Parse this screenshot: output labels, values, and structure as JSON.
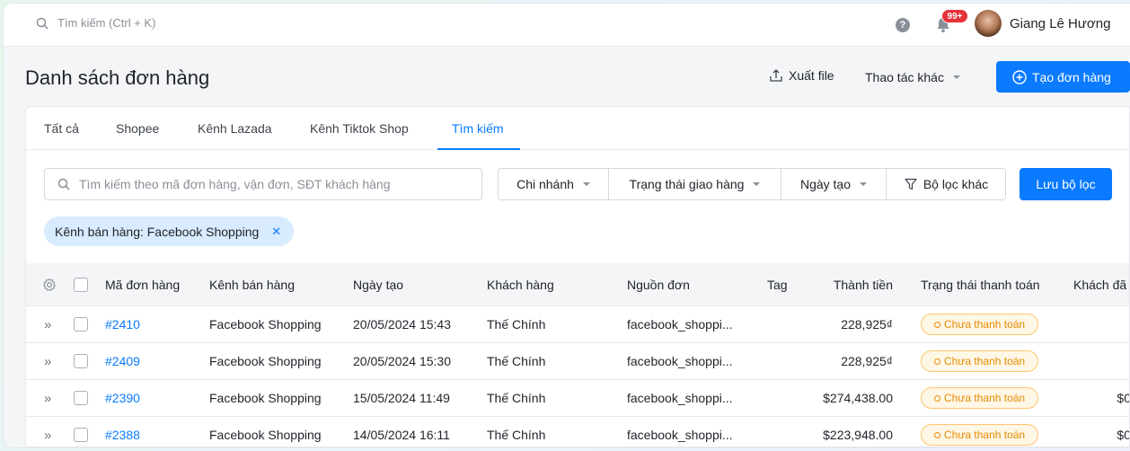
{
  "topbar": {
    "search_placeholder": "Tìm kiếm (Ctrl + K)",
    "notification_count": "99+",
    "user_name": "Giang Lê Hương"
  },
  "header": {
    "title": "Danh sách đơn hàng",
    "export_label": "Xuất file",
    "more_actions_label": "Thao tác khác",
    "create_label": "Tạo đơn hàng"
  },
  "tabs": [
    "Tất cả",
    "Shopee",
    "Kênh Lazada",
    "Kênh Tiktok Shop",
    "Tìm kiếm"
  ],
  "active_tab": "Tìm kiếm",
  "filters": {
    "search_placeholder": "Tìm kiếm theo mã đơn hàng, vận đơn, SĐT khách hàng",
    "branch": "Chi nhánh",
    "delivery_status": "Trạng thái giao hàng",
    "created_date": "Ngày tạo",
    "other_filters": "Bộ lọc khác",
    "save_filter": "Lưu bộ lọc",
    "active_chip": "Kênh bán hàng: Facebook Shopping"
  },
  "table": {
    "columns": [
      "Mã đơn hàng",
      "Kênh bán hàng",
      "Ngày tạo",
      "Khách hàng",
      "Nguồn đơn",
      "Tag",
      "Thành tiền",
      "Trạng thái thanh toán",
      "Khách đã"
    ],
    "rows": [
      {
        "id": "#2410",
        "channel": "Facebook Shopping",
        "date": "20/05/2024 15:43",
        "customer": "Thế Chính",
        "source": "facebook_shoppi...",
        "tag": "",
        "total": "228,925₫",
        "payment_status": "Chưa thanh toán",
        "paid": ""
      },
      {
        "id": "#2409",
        "channel": "Facebook Shopping",
        "date": "20/05/2024 15:30",
        "customer": "Thế Chính",
        "source": "facebook_shoppi...",
        "tag": "",
        "total": "228,925₫",
        "payment_status": "Chưa thanh toán",
        "paid": ""
      },
      {
        "id": "#2390",
        "channel": "Facebook Shopping",
        "date": "15/05/2024 11:49",
        "customer": "Thế Chính",
        "source": "facebook_shoppi...",
        "tag": "",
        "total": "$274,438.00",
        "payment_status": "Chưa thanh toán",
        "paid": "$0"
      },
      {
        "id": "#2388",
        "channel": "Facebook Shopping",
        "date": "14/05/2024 16:11",
        "customer": "Thế Chính",
        "source": "facebook_shoppi...",
        "tag": "",
        "total": "$223,948.00",
        "payment_status": "Chưa thanh toán",
        "paid": "$0"
      }
    ]
  },
  "colors": {
    "accent": "#0a7aff",
    "badge_text": "#e58a00",
    "badge_border": "#ffc56e",
    "notification": "#e5323a"
  },
  "icons": [
    "search-icon",
    "help-icon",
    "bell-icon",
    "export-icon",
    "plus-circle-icon",
    "funnel-icon",
    "gear-icon",
    "expand-icon",
    "close-icon",
    "chevron-down-icon"
  ]
}
